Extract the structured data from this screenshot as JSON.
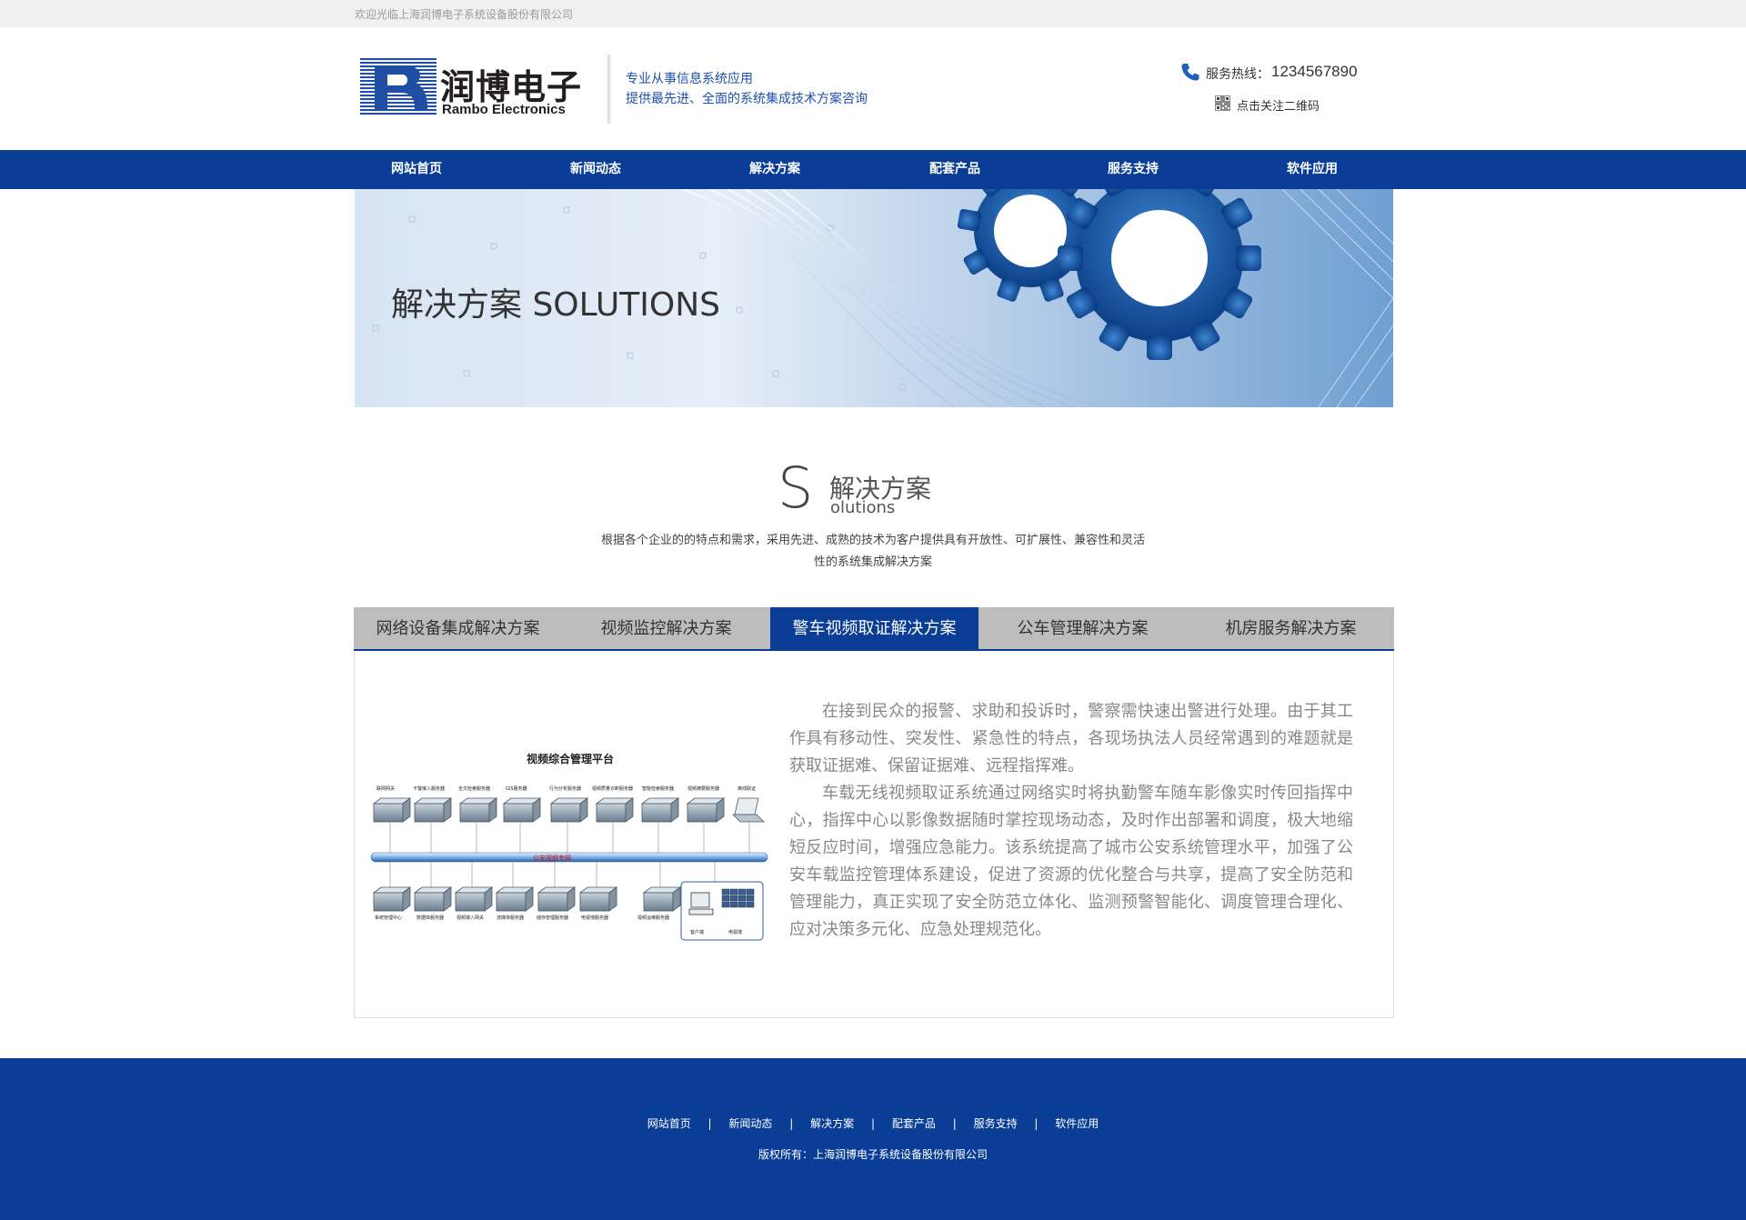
{
  "topbar": {
    "welcome": "欢迎光临上海润博电子系统设备股份有限公司"
  },
  "header": {
    "logo_cn": "润博电子",
    "logo_en": "Rambo Electronics",
    "slogan_line1": "专业从事信息系统应用",
    "slogan_line2": "提供最先进、全面的系统集成技术方案咨询",
    "hotline_label": "服务热线：",
    "hotline_number": "1234567890",
    "qr_label": "点击关注二维码"
  },
  "nav": {
    "items": [
      {
        "label": "网站首页"
      },
      {
        "label": "新闻动态"
      },
      {
        "label": "解决方案"
      },
      {
        "label": "配套产品"
      },
      {
        "label": "服务支持"
      },
      {
        "label": "软件应用"
      }
    ]
  },
  "banner": {
    "title": "解决方案 SOLUTIONS"
  },
  "section": {
    "big_letter": "S",
    "title_cn": "解决方案",
    "title_en": "olutions",
    "description": "根据各个企业的的特点和需求，采用先进、成熟的技术为客户提供具有开放性、可扩展性、兼容性和灵活性的系统集成解决方案"
  },
  "tabs": {
    "items": [
      {
        "label": "网络设备集成解决方案"
      },
      {
        "label": "视频监控解决方案"
      },
      {
        "label": "警车视频取证解决方案",
        "active": true
      },
      {
        "label": "公车管理解决方案"
      },
      {
        "label": "机房服务解决方案"
      }
    ]
  },
  "content": {
    "diagram": {
      "title": "视频综合管理平台",
      "network_label": "公安视频专网",
      "top_labels": [
        "联网网关",
        "卡警接入服务器",
        "全文检索服务器",
        "GIS服务器",
        "行为分析服务器",
        "视频质量诊断服务器",
        "智能检索服务器",
        "视频摘要服务器",
        "离线取证"
      ],
      "bottom_labels": [
        "系统管理中心",
        "数据库服务器",
        "视频接入网关",
        "流媒体服务器",
        "储存管理服务器",
        "电视墙服务器",
        "视频运维服务器",
        "客户端",
        "电视墙"
      ]
    },
    "paragraphs": [
      "在接到民众的报警、求助和投诉时，警察需快速出警进行处理。由于其工作具有移动性、突发性、紧急性的特点，各现场执法人员经常遇到的难题就是获取证据难、保留证据难、远程指挥难。",
      "车载无线视频取证系统通过网络实时将执勤警车随车影像实时传回指挥中心，指挥中心以影像数据随时掌控现场动态，及时作出部署和调度，极大地缩短反应时间，增强应急能力。该系统提高了城市公安系统管理水平，加强了公安车载监控管理体系建设，促进了资源的优化整合与共享，提高了安全防范和管理能力，真正实现了安全防范立体化、监测预警智能化、调度管理合理化、应对决策多元化、应急处理规范化。"
    ]
  },
  "footer": {
    "links": [
      "网站首页",
      "新闻动态",
      "解决方案",
      "配套产品",
      "服务支持",
      "软件应用"
    ],
    "separator": "|",
    "copyright": "版权所有：上海润博电子系统设备股份有限公司"
  },
  "colors": {
    "brand_blue": "#0a3d96",
    "slogan_blue": "#1e4fa8",
    "tab_gray": "#bdbdbd"
  },
  "icons": {
    "phone": "phone-icon",
    "qr": "qr-code-icon"
  }
}
